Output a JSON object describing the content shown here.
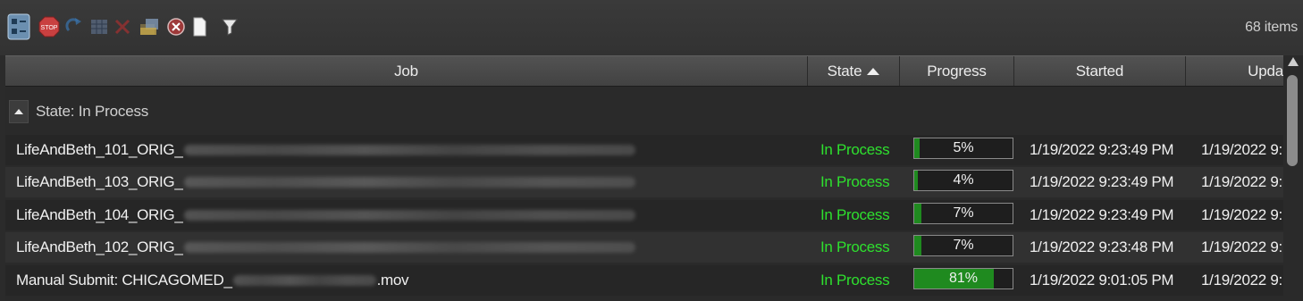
{
  "toolbar": {
    "icons": [
      "view-toggle-icon",
      "stop-icon",
      "resume-icon",
      "grid-icon",
      "delete-icon",
      "open-folder-icon",
      "cancel-icon",
      "document-icon",
      "filter-icon"
    ],
    "stop_text": "STOP",
    "item_count": "68 items"
  },
  "columns": {
    "job": "Job",
    "state": "State",
    "progress": "Progress",
    "started": "Started",
    "updated": "Upda"
  },
  "group": {
    "label": "State: In Process"
  },
  "rows": [
    {
      "job": "LifeAndBeth_101_ORIG_",
      "job_suffix": "",
      "state": "In Process",
      "progress": 0.05,
      "progress_label": "5%",
      "started": "1/19/2022 9:23:49 PM",
      "updated": "1/19/2022 9:"
    },
    {
      "job": "LifeAndBeth_103_ORIG_",
      "job_suffix": "",
      "state": "In Process",
      "progress": 0.04,
      "progress_label": "4%",
      "started": "1/19/2022 9:23:49 PM",
      "updated": "1/19/2022 9:"
    },
    {
      "job": "LifeAndBeth_104_ORIG_",
      "job_suffix": "",
      "state": "In Process",
      "progress": 0.07,
      "progress_label": "7%",
      "started": "1/19/2022 9:23:49 PM",
      "updated": "1/19/2022 9:"
    },
    {
      "job": "LifeAndBeth_102_ORIG_",
      "job_suffix": "",
      "state": "In Process",
      "progress": 0.07,
      "progress_label": "7%",
      "started": "1/19/2022 9:23:48 PM",
      "updated": "1/19/2022 9:"
    },
    {
      "job": "Manual Submit: CHICAGOMED_",
      "job_suffix": ".mov",
      "state": "In Process",
      "progress": 0.81,
      "progress_label": "81%",
      "started": "1/19/2022 9:01:05 PM",
      "updated": "1/19/2022 9:"
    }
  ],
  "colors": {
    "state_in_process": "#2ee02e",
    "progress_fill": "#1f8a1f",
    "accent_blue": "#3a8fd9"
  }
}
